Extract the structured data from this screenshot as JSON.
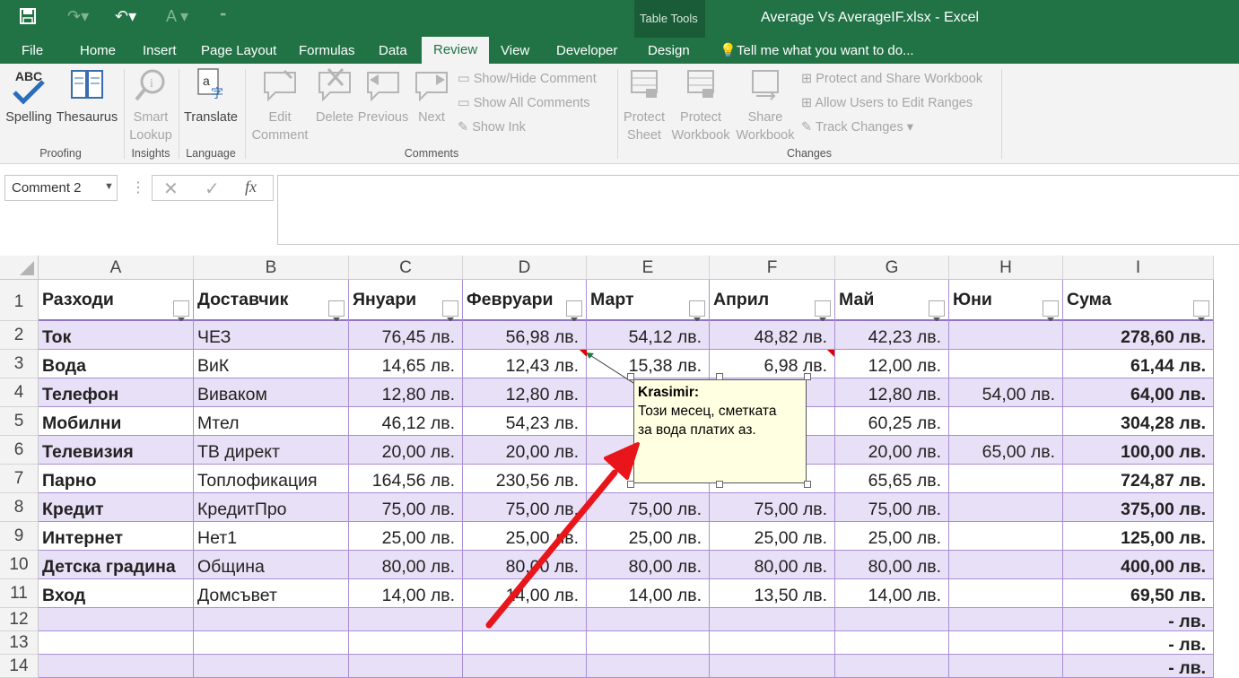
{
  "window": {
    "title": "Average Vs AverageIF.xlsx - Excel",
    "context_tab_group": "Table Tools"
  },
  "menu_tabs": [
    "File",
    "Home",
    "Insert",
    "Page Layout",
    "Formulas",
    "Data",
    "Review",
    "View",
    "Developer",
    "Design"
  ],
  "active_tab": "Review",
  "tell_me": "Tell me what you want to do...",
  "ribbon": {
    "spelling": "Spelling",
    "thesaurus": "Thesaurus",
    "smart_lookup_1": "Smart",
    "smart_lookup_2": "Lookup",
    "translate": "Translate",
    "edit_comment_1": "Edit",
    "edit_comment_2": "Comment",
    "delete": "Delete",
    "previous": "Previous",
    "next": "Next",
    "show_hide_comment": "Show/Hide Comment",
    "show_all_comments": "Show All Comments",
    "show_ink": "Show Ink",
    "protect_sheet_1": "Protect",
    "protect_sheet_2": "Sheet",
    "protect_workbook_1": "Protect",
    "protect_workbook_2": "Workbook",
    "share_workbook_1": "Share",
    "share_workbook_2": "Workbook",
    "protect_share": "Protect and Share Workbook",
    "allow_users": "Allow Users to Edit Ranges",
    "track_changes": "Track Changes",
    "groups": {
      "proofing": "Proofing",
      "insights": "Insights",
      "language": "Language",
      "comments": "Comments",
      "changes": "Changes"
    }
  },
  "namebox": {
    "value": "Comment 2"
  },
  "columns": [
    "A",
    "B",
    "C",
    "D",
    "E",
    "F",
    "G",
    "H",
    "I"
  ],
  "headers": [
    "Разходи",
    "Доставчик",
    "Януари",
    "Февруари",
    "Март",
    "Април",
    "Май",
    "Юни",
    "Сума"
  ],
  "rows": [
    [
      "Ток",
      "ЧЕЗ",
      "76,45 лв.",
      "56,98 лв.",
      "54,12 лв.",
      "48,82 лв.",
      "42,23 лв.",
      "",
      "278,60 лв."
    ],
    [
      "Вода",
      "ВиК",
      "14,65 лв.",
      "12,43 лв.",
      "15,38 лв.",
      "6,98 лв.",
      "12,00 лв.",
      "",
      "61,44 лв."
    ],
    [
      "Телефон",
      "Виваком",
      "12,80 лв.",
      "12,80 лв.",
      "1",
      "",
      "12,80 лв.",
      "54,00 лв.",
      "64,00 лв."
    ],
    [
      "Мобилни",
      "Мтел",
      "46,12 лв.",
      "54,23 лв.",
      "6",
      "",
      "60,25 лв.",
      "",
      "304,28 лв."
    ],
    [
      "Телевизия",
      "ТВ директ",
      "20,00 лв.",
      "20,00 лв.",
      "2",
      "",
      "20,00 лв.",
      "65,00 лв.",
      "100,00 лв."
    ],
    [
      "Парно",
      "Топлофикация",
      "164,56 лв.",
      "230,56 лв.",
      "",
      "",
      "65,65 лв.",
      "",
      "724,87 лв."
    ],
    [
      "Кредит",
      "КредитПро",
      "75,00 лв.",
      "75,00 лв.",
      "75,00 лв.",
      "75,00 лв.",
      "75,00 лв.",
      "",
      "375,00 лв."
    ],
    [
      "Интернет",
      "Нет1",
      "25,00 лв.",
      "25,00 лв.",
      "25,00 лв.",
      "25,00 лв.",
      "25,00 лв.",
      "",
      "125,00 лв."
    ],
    [
      "Детска градина",
      "Община",
      "80,00 лв.",
      "80,00 лв.",
      "80,00 лв.",
      "80,00 лв.",
      "80,00 лв.",
      "",
      "400,00 лв."
    ],
    [
      "Вход",
      "Домсъвет",
      "14,00 лв.",
      "14,00 лв.",
      "14,00 лв.",
      "13,50 лв.",
      "14,00 лв.",
      "",
      "69,50 лв."
    ],
    [
      "",
      "",
      "",
      "",
      "",
      "",
      "",
      "",
      "-     лв."
    ],
    [
      "",
      "",
      "",
      "",
      "",
      "",
      "",
      "",
      "-     лв."
    ],
    [
      "",
      "",
      "",
      "",
      "",
      "",
      "",
      "",
      "-     лв."
    ]
  ],
  "row_numbers": [
    "1",
    "2",
    "3",
    "4",
    "5",
    "6",
    "7",
    "8",
    "9",
    "10",
    "11",
    "12",
    "13",
    "14"
  ],
  "comment": {
    "author": "Krasimir:",
    "line1": "Този месец, сметката",
    "line2": "за вода платих аз."
  },
  "colors": {
    "excel_green": "#217346",
    "band": "#e8e0f6",
    "comment_bg": "#ffffe1",
    "arrow": "#e8151b"
  }
}
